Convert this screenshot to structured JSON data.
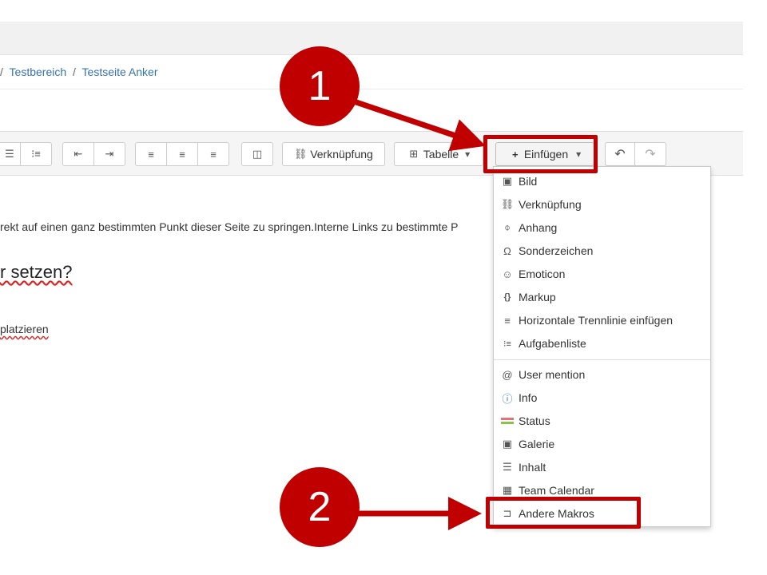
{
  "breadcrumb": {
    "sep": "/",
    "items": [
      "Testbereich",
      "Testseite Anker"
    ]
  },
  "toolbar": {
    "link_label": "Verknüpfung",
    "table_label": "Tabelle",
    "insert_label": "Einfügen"
  },
  "content": {
    "p1": "rekt auf einen ganz bestimmten Punkt dieser Seite zu springen.Interne Links zu bestimmte P",
    "heading": "r setzen?",
    "p2": "platzieren"
  },
  "menu": {
    "items_a": [
      {
        "label": "Bild",
        "icon": "image-icon"
      },
      {
        "label": "Verknüpfung",
        "icon": "link-icon"
      },
      {
        "label": "Anhang",
        "icon": "paperclip-icon"
      },
      {
        "label": "Sonderzeichen",
        "icon": "omega-icon"
      },
      {
        "label": "Emoticon",
        "icon": "smiley-icon"
      },
      {
        "label": "Markup",
        "icon": "braces-icon"
      },
      {
        "label": "Horizontale Trennlinie einfügen",
        "icon": "horizontal-rule-icon"
      },
      {
        "label": "Aufgabenliste",
        "icon": "tasklist-icon"
      }
    ],
    "items_b": [
      {
        "label": "User mention",
        "icon": "at-icon"
      },
      {
        "label": "Info",
        "icon": "info-icon"
      },
      {
        "label": "Status",
        "icon": "status-icon"
      },
      {
        "label": "Galerie",
        "icon": "gallery-icon"
      },
      {
        "label": "Inhalt",
        "icon": "toc-icon"
      },
      {
        "label": "Team Calendar",
        "icon": "calendar-icon"
      },
      {
        "label": "Andere Makros",
        "icon": "macro-icon"
      }
    ]
  },
  "annotations": {
    "step1": "1",
    "step2": "2",
    "color": "#c00000"
  }
}
